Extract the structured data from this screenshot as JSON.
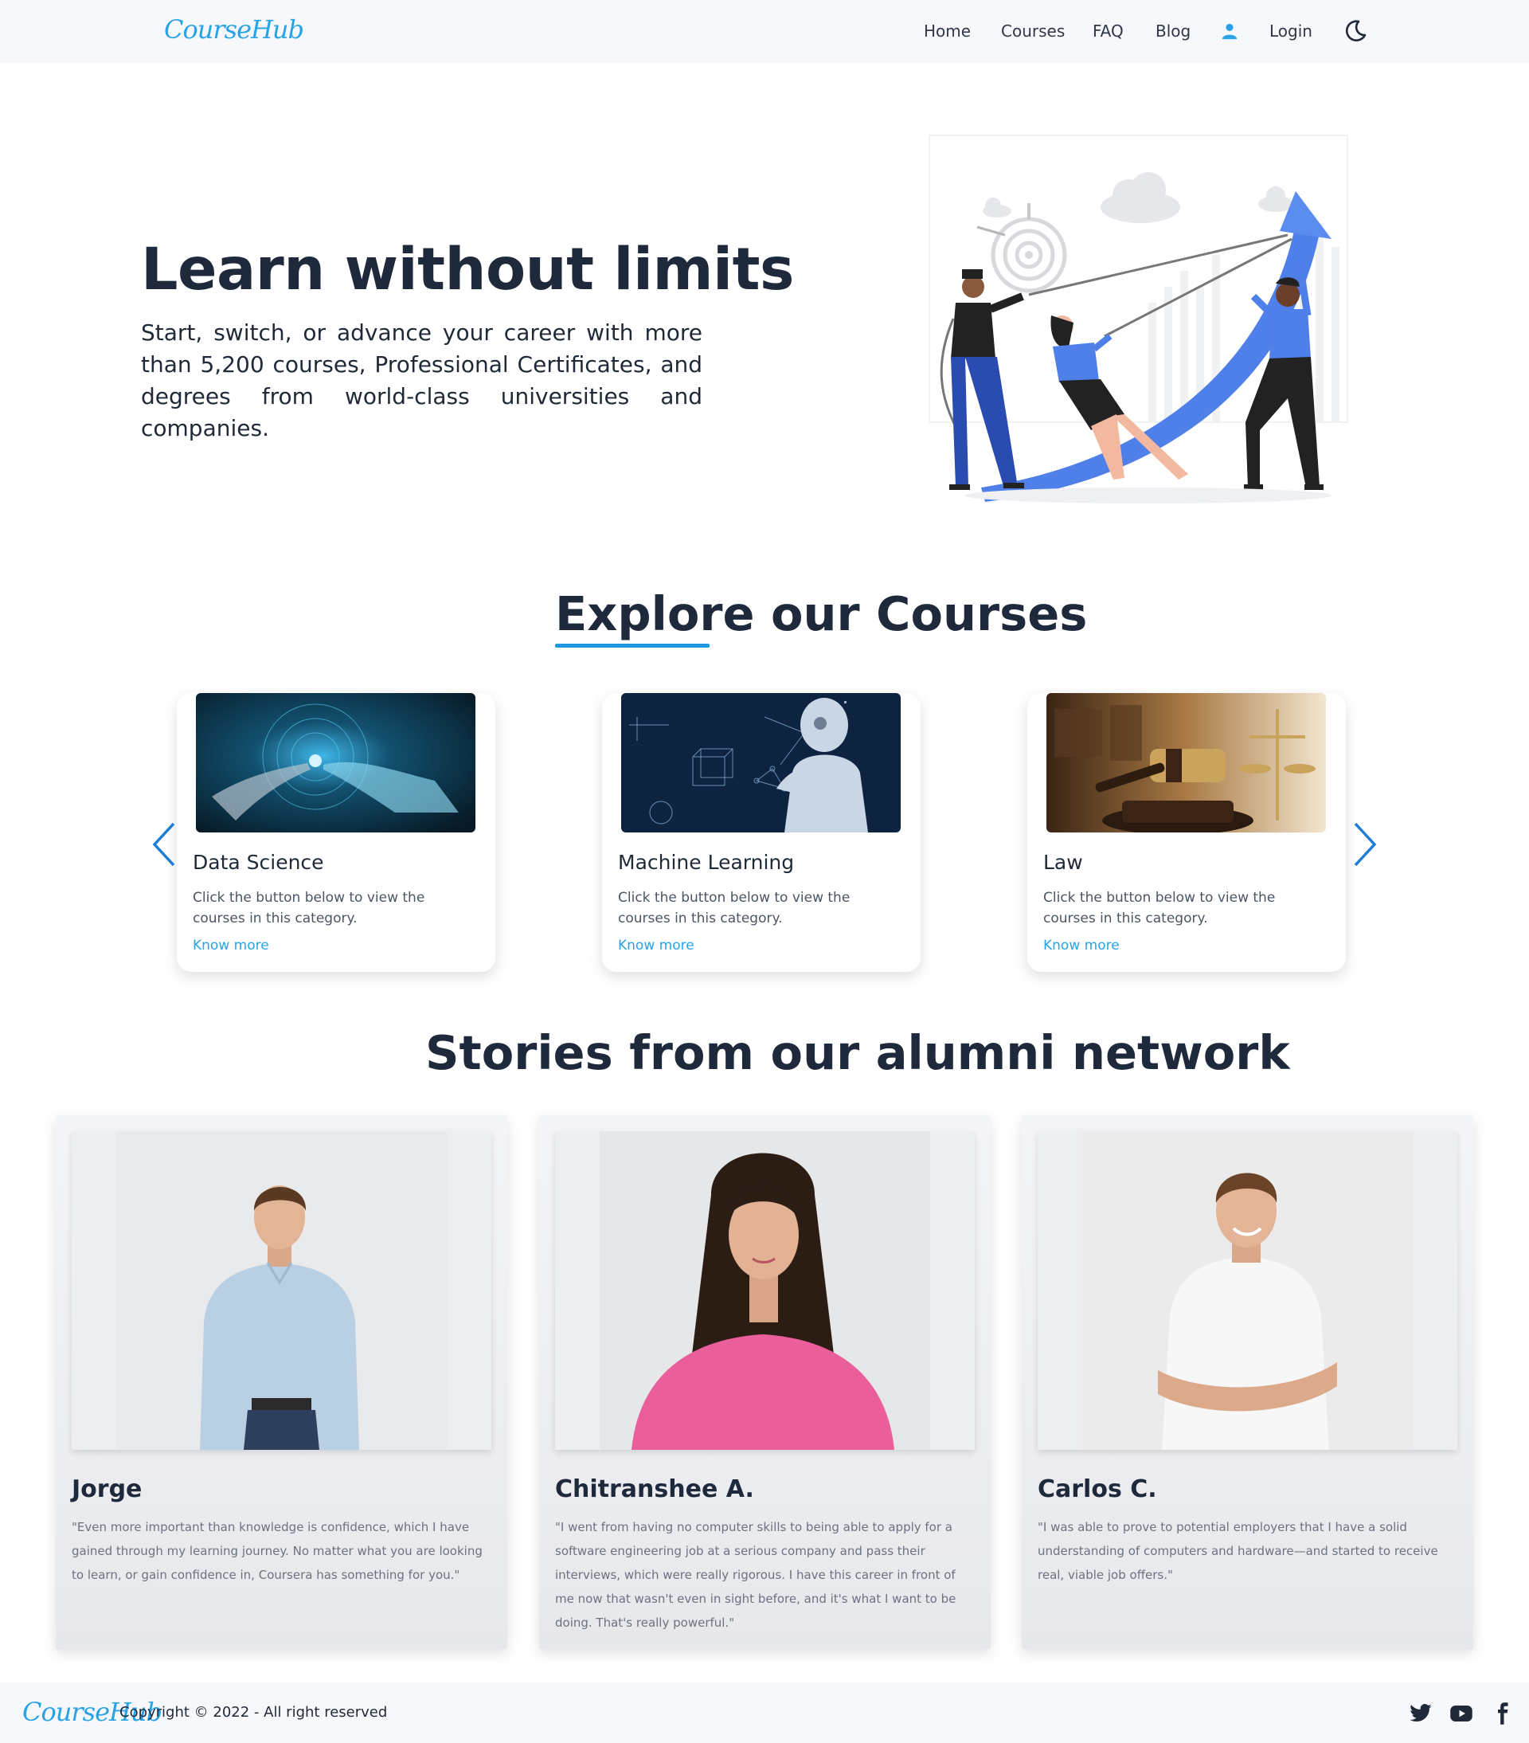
{
  "brand": {
    "logo_text": "CourseHub"
  },
  "nav": {
    "items": [
      {
        "label": "Home"
      },
      {
        "label": "Courses"
      },
      {
        "label": "FAQ"
      },
      {
        "label": "Blog"
      }
    ],
    "login_label": "Login",
    "user_icon": "user-icon",
    "theme_icon": "moon-icon"
  },
  "hero": {
    "title": "Learn without limits",
    "text": "Start, switch, or advance your career with more than 5,200 courses, Professional Certificates, and degrees from world-class universities and companies."
  },
  "courses": {
    "title": "Explore our Courses",
    "prev_icon": "chevron-left-icon",
    "next_icon": "chevron-right-icon",
    "items": [
      {
        "title": "Data Science",
        "description": "Click the button below to view the courses in this category.",
        "link": "Know more"
      },
      {
        "title": "Machine Learning",
        "description": "Click the button below to view the courses in this category.",
        "link": "Know more"
      },
      {
        "title": "Law",
        "description": "Click the button below to view the courses in this category.",
        "link": "Know more"
      }
    ]
  },
  "alumni": {
    "title": "Stories from our alumni network",
    "items": [
      {
        "name": "Jorge",
        "quote": "\"Even more important than knowledge is confidence, which I have gained through my learning journey. No matter what you are looking to learn, or gain confidence in, Coursera has something for you.\""
      },
      {
        "name": "Chitranshee A.",
        "quote": "\"I went from having no computer skills to being able to apply for a software engineering job at a serious company and pass their interviews, which were really rigorous. I have this career in front of me now that wasn't even in sight before, and it's what I want to be doing. That's really powerful.\""
      },
      {
        "name": "Carlos C.",
        "quote": "\"I was able to prove to potential employers that I have a solid understanding of computers and hardware—and started to receive real, viable job offers.\""
      }
    ]
  },
  "footer": {
    "logo_text": "CourseHub",
    "copyright": "Copyright © 2022 - All right reserved",
    "social_icons": [
      "twitter-icon",
      "youtube-icon",
      "facebook-icon"
    ]
  },
  "colors": {
    "accent": "#29a3e6",
    "underline": "#1e9ae0",
    "heading": "#1e293b",
    "nav_bg": "#f6f8fb"
  }
}
